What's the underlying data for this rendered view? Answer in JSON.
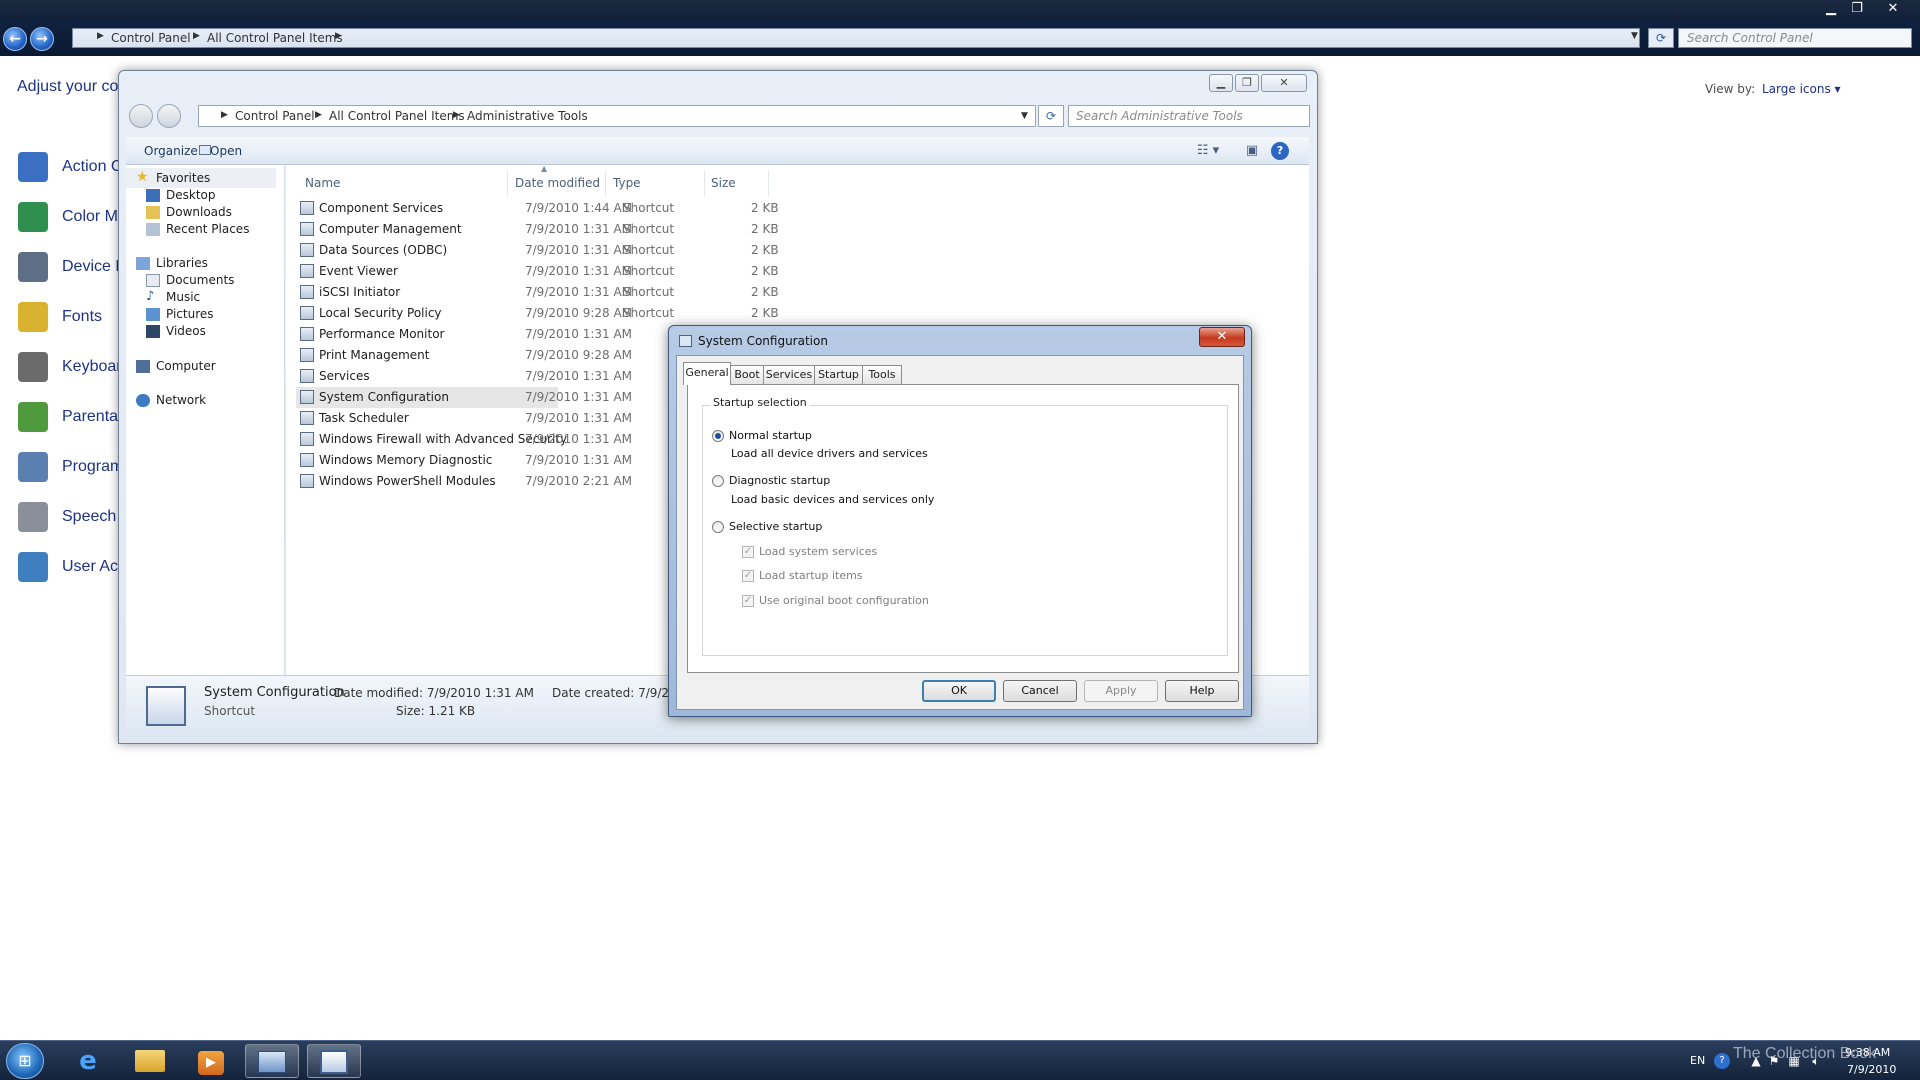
{
  "control_panel": {
    "breadcrumb": [
      "Control Panel",
      "All Control Panel Items"
    ],
    "search_placeholder": "Search Control Panel",
    "heading": "Adjust your co",
    "view_by_label": "View by:",
    "view_by_value": "Large icons",
    "items": [
      {
        "label": "Action C",
        "color": "#3a6fc4"
      },
      {
        "label": "Color M",
        "color": "#2f8f4e"
      },
      {
        "label": "Device M",
        "color": "#5e6e85"
      },
      {
        "label": "Fonts",
        "color": "#d9b230"
      },
      {
        "label": "Keyboar",
        "color": "#6b6b6b"
      },
      {
        "label": "Parental",
        "color": "#4f9a3c"
      },
      {
        "label": "Program",
        "color": "#5a7fb0"
      },
      {
        "label": "Speech",
        "color": "#8a8f99"
      },
      {
        "label": "User Acc",
        "color": "#3f7fbf"
      }
    ]
  },
  "explorer": {
    "breadcrumb": [
      "Control Panel",
      "All Control Panel Items",
      "Administrative Tools"
    ],
    "search_placeholder": "Search Administrative Tools",
    "toolbar": {
      "organize": "Organize",
      "open": "Open"
    },
    "nav": {
      "favorites": "Favorites",
      "favorites_items": [
        "Desktop",
        "Downloads",
        "Recent Places"
      ],
      "libraries": "Libraries",
      "libraries_items": [
        "Documents",
        "Music",
        "Pictures",
        "Videos"
      ],
      "computer": "Computer",
      "network": "Network"
    },
    "columns": {
      "name": "Name",
      "date": "Date modified",
      "type": "Type",
      "size": "Size"
    },
    "files": [
      {
        "name": "Component Services",
        "date": "7/9/2010 1:44 AM",
        "type": "Shortcut",
        "size": "2 KB"
      },
      {
        "name": "Computer Management",
        "date": "7/9/2010 1:31 AM",
        "type": "Shortcut",
        "size": "2 KB"
      },
      {
        "name": "Data Sources (ODBC)",
        "date": "7/9/2010 1:31 AM",
        "type": "Shortcut",
        "size": "2 KB"
      },
      {
        "name": "Event Viewer",
        "date": "7/9/2010 1:31 AM",
        "type": "Shortcut",
        "size": "2 KB"
      },
      {
        "name": "iSCSI Initiator",
        "date": "7/9/2010 1:31 AM",
        "type": "Shortcut",
        "size": "2 KB"
      },
      {
        "name": "Local Security Policy",
        "date": "7/9/2010 9:28 AM",
        "type": "Shortcut",
        "size": "2 KB"
      },
      {
        "name": "Performance Monitor",
        "date": "7/9/2010 1:31 AM",
        "type": "",
        "size": ""
      },
      {
        "name": "Print Management",
        "date": "7/9/2010 9:28 AM",
        "type": "",
        "size": ""
      },
      {
        "name": "Services",
        "date": "7/9/2010 1:31 AM",
        "type": "",
        "size": ""
      },
      {
        "name": "System Configuration",
        "date": "7/9/2010 1:31 AM",
        "type": "",
        "size": ""
      },
      {
        "name": "Task Scheduler",
        "date": "7/9/2010 1:31 AM",
        "type": "",
        "size": ""
      },
      {
        "name": "Windows Firewall with Advanced Security",
        "date": "7/9/2010 1:31 AM",
        "type": "",
        "size": ""
      },
      {
        "name": "Windows Memory Diagnostic",
        "date": "7/9/2010 1:31 AM",
        "type": "",
        "size": ""
      },
      {
        "name": "Windows PowerShell Modules",
        "date": "7/9/2010 2:21 AM",
        "type": "",
        "size": ""
      }
    ],
    "details": {
      "name": "System Configuration",
      "kind": "Shortcut",
      "date_modified": "Date modified: 7/9/2010 1:31 AM",
      "size": "Size: 1.21 KB",
      "date_created": "Date created: 7/9/20"
    }
  },
  "dialog": {
    "title": "System Configuration",
    "tabs": [
      "General",
      "Boot",
      "Services",
      "Startup",
      "Tools"
    ],
    "group_label": "Startup selection",
    "options": [
      {
        "label": "Normal startup",
        "desc": "Load all device drivers and services",
        "selected": true
      },
      {
        "label": "Diagnostic startup",
        "desc": "Load basic devices and services only",
        "selected": false
      },
      {
        "label": "Selective startup",
        "desc": "",
        "selected": false
      }
    ],
    "checkboxes": [
      "Load system services",
      "Load startup items",
      "Use original boot configuration"
    ],
    "buttons": {
      "ok": "OK",
      "cancel": "Cancel",
      "apply": "Apply",
      "help": "Help"
    }
  },
  "taskbar": {
    "language": "EN",
    "time": "9:38 AM",
    "date": "7/9/2010",
    "watermark": "The Collection Book"
  }
}
